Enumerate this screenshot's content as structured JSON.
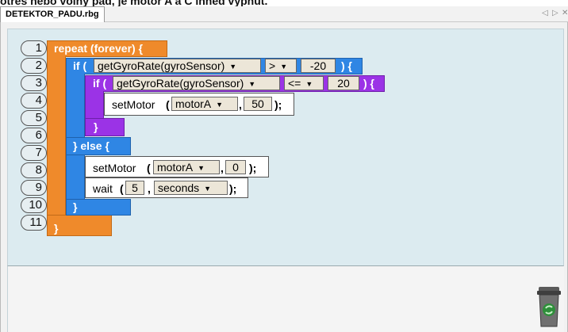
{
  "top_caption": "otřes nebo volný pád, je motor A a C ihned vypnut.",
  "tab": {
    "title": "DETEKTOR_PADU.rbg",
    "prev_icon": "triangle-left",
    "next_icon": "triangle-right",
    "close_icon": "close-x"
  },
  "line_numbers": [
    "1",
    "2",
    "3",
    "4",
    "5",
    "6",
    "7",
    "8",
    "9",
    "10",
    "11"
  ],
  "code": {
    "repeat": "repeat (forever) {",
    "if1_open": "if (",
    "if1_func": "getGyroRate(gyroSensor)",
    "if1_op": ">",
    "if1_val": "-20",
    "if1_close": ") {",
    "if2_open": "if (",
    "if2_func": "getGyroRate(gyroSensor)",
    "if2_op": "<=",
    "if2_val": "20",
    "if2_close": ") {",
    "set1_name": "setMotor",
    "set1_paren": "(",
    "set1_motor": "motorA",
    "set1_comma": ",",
    "set1_val": "50",
    "set1_end": ");",
    "if2_end": "}",
    "else": "} else {",
    "set2_name": "setMotor",
    "set2_paren": "(",
    "set2_motor": "motorA",
    "set2_comma": ",",
    "set2_val": "0",
    "set2_end": ");",
    "wait_name": "wait",
    "wait_paren": "(",
    "wait_val": "5",
    "wait_comma": ",",
    "wait_unit": "seconds",
    "wait_end": ");",
    "if1_end": "}",
    "repeat_end": "}"
  },
  "colors": {
    "loop": "#ef8a2b",
    "if": "#2f86e4",
    "nested_if": "#9b33e6",
    "workspace": "#dcebf0"
  },
  "trash": {
    "icon": "recycle-bin-icon"
  }
}
